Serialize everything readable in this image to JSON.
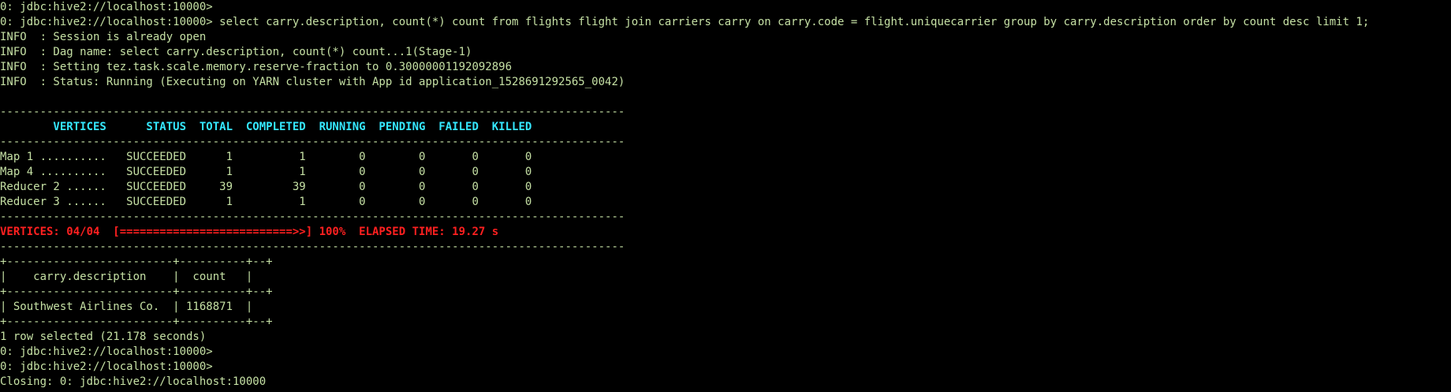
{
  "terminal": {
    "colors": {
      "background": "#000000",
      "text": "#c5e0a4",
      "header": "#35e8ff",
      "progress": "#ff2020"
    },
    "lines": {
      "l01": "0: jdbc:hive2://localhost:10000>",
      "l02": "0: jdbc:hive2://localhost:10000> select carry.description, count(*) count from flights flight join carriers carry on carry.code = flight.uniquecarrier group by carry.description order by count desc limit 1;",
      "l03": "INFO  : Session is already open",
      "l04": "INFO  : Dag name: select carry.description, count(*) count...1(Stage-1)",
      "l05": "INFO  : Setting tez.task.scale.memory.reserve-fraction to 0.30000001192092896",
      "l06": "INFO  : Status: Running (Executing on YARN cluster with App id application_1528691292565_0042)",
      "l07": "",
      "l08": "----------------------------------------------------------------------------------------------",
      "l09": "        VERTICES      STATUS  TOTAL  COMPLETED  RUNNING  PENDING  FAILED  KILLED",
      "l10": "----------------------------------------------------------------------------------------------",
      "l11": "Map 1 ..........   SUCCEEDED      1          1        0        0       0       0",
      "l12": "Map 4 ..........   SUCCEEDED      1          1        0        0       0       0",
      "l13": "Reducer 2 ......   SUCCEEDED     39         39        0        0       0       0",
      "l14": "Reducer 3 ......   SUCCEEDED      1          1        0        0       0       0",
      "l15": "----------------------------------------------------------------------------------------------",
      "l16": "VERTICES: 04/04  [==========================>>] 100%  ELAPSED TIME: 19.27 s",
      "l17": "----------------------------------------------------------------------------------------------",
      "l18": "+-------------------------+----------+--+",
      "l19": "|    carry.description    |  count   |",
      "l20": "+-------------------------+----------+--+",
      "l21": "| Southwest Airlines Co.  | 1168871  |",
      "l22": "+-------------------------+----------+--+",
      "l23": "1 row selected (21.178 seconds)",
      "l24": "0: jdbc:hive2://localhost:10000>",
      "l25": "0: jdbc:hive2://localhost:10000>",
      "l26": "Closing: 0: jdbc:hive2://localhost:10000"
    }
  }
}
